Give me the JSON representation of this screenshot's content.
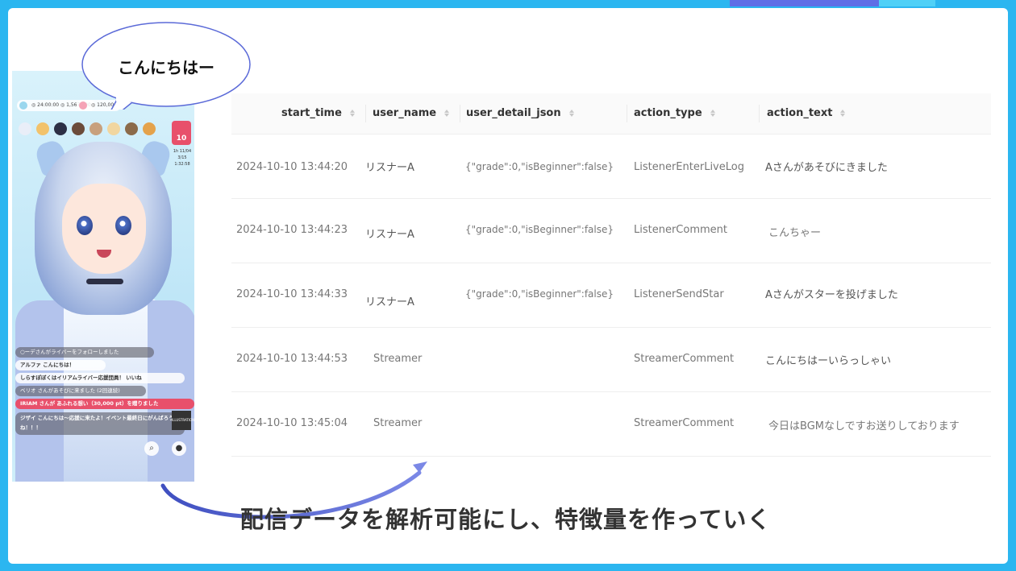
{
  "bubble": {
    "text": "こんにちはー"
  },
  "stream": {
    "stat1": "◎ 24:00:00 ◎ 1,567,890",
    "stat2": "◎ 120,000",
    "rank": "10",
    "rank_meta": "1h 11/04 3/15 1:32:58",
    "chat": [
      "○ーデさんがライバーをフォローしました",
      "アルファ こんにちは！",
      "しらすぽぼくはイリアムライバー応援団員！ いいね",
      "ベリオ さんがあそびに来ました (2回連続)",
      "IRIAM さんが あふれる想い（30,000 pt）を贈りました"
    ],
    "chat_long": "ジザイ こんにちは～応援に来たよ！イベント最終日にがんばろうね！！！",
    "chat_thumb": "ILLUSTRATION"
  },
  "table": {
    "columns": [
      "start_time",
      "user_name",
      "user_detail_json",
      "action_type",
      "action_text"
    ],
    "rows": [
      [
        "2024-10-10 13:44:20",
        "リスナーA",
        "{\"grade\":0,\"isBeginner\":false}",
        "ListenerEnterLiveLog",
        "Aさんがあそびにきました"
      ],
      [
        "2024-10-10 13:44:23",
        "リスナーA",
        "{\"grade\":0,\"isBeginner\":false}",
        "ListenerComment",
        "こんちゃー"
      ],
      [
        "2024-10-10 13:44:33",
        "リスナーA",
        "{\"grade\":0,\"isBeginner\":false}",
        "ListenerSendStar",
        "Aさんがスターを投げました"
      ],
      [
        "2024-10-10 13:44:53",
        "Streamer",
        "",
        "StreamerComment",
        "こんにちはーいらっしゃい"
      ],
      [
        "2024-10-10 13:45:04",
        "Streamer",
        "",
        "StreamerComment",
        "今日はBGMなしですお送りしております"
      ]
    ]
  },
  "caption": "配信データを解析可能にし、特徴量を作っていく",
  "colors": {
    "accent": "#5b6ad8",
    "frame": "#2bb6f0"
  }
}
